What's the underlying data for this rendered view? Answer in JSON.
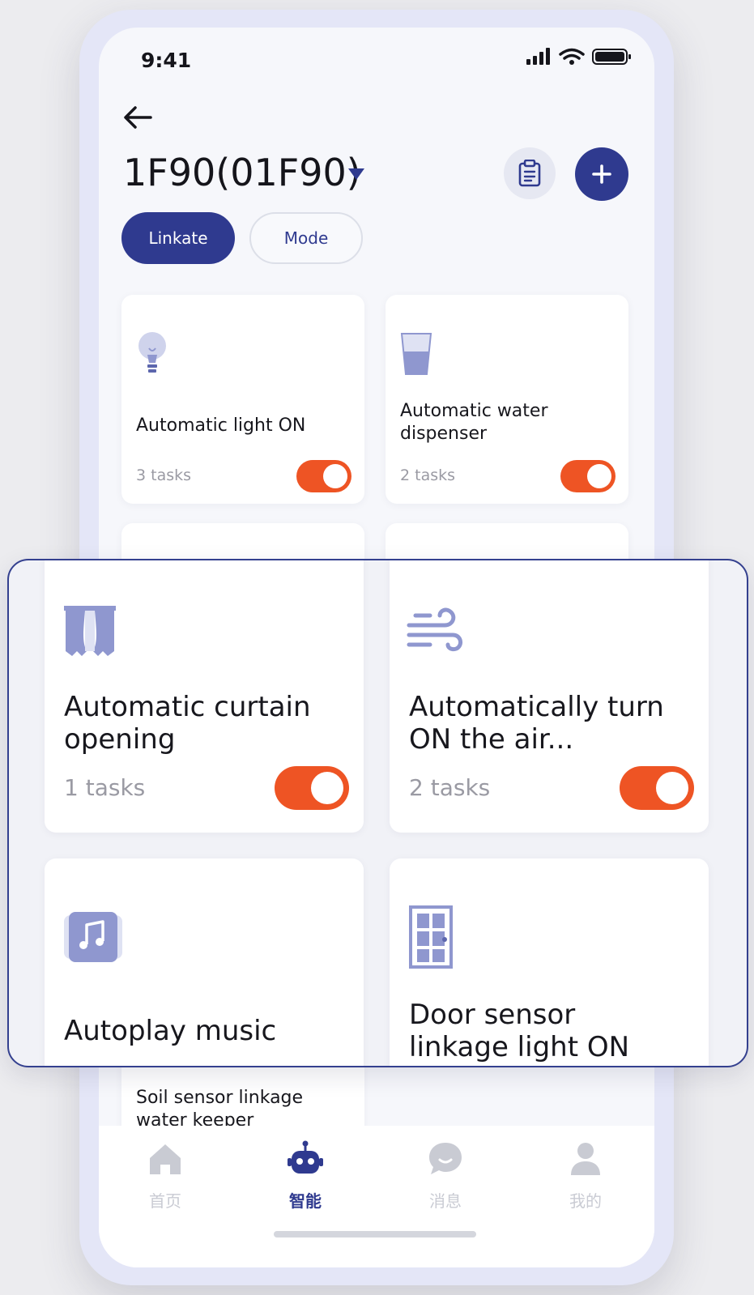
{
  "status_bar": {
    "time": "9:41"
  },
  "header": {
    "title": "1F90(01F90)"
  },
  "tabs": [
    {
      "label": "Linkate",
      "active": true
    },
    {
      "label": "Mode",
      "active": false
    }
  ],
  "scenes": [
    {
      "name": "Automatic light ON",
      "tasks": "3 tasks",
      "icon": "lightbulb-icon",
      "enabled": true
    },
    {
      "name": "Automatic water dispenser",
      "tasks": "2 tasks",
      "icon": "water-glass-icon",
      "enabled": true
    },
    {
      "name": "Soil sensor linkage water keeper",
      "icon": "soil-sensor-icon"
    }
  ],
  "zoomed_scenes": [
    {
      "name_line1": "Automatic curtain",
      "name_line2": "opening",
      "tasks": "1 tasks",
      "icon": "curtain-icon",
      "enabled": true
    },
    {
      "name_line1": "Automatically turn",
      "name_line2": "ON the air...",
      "tasks": "2 tasks",
      "icon": "wind-icon",
      "enabled": true
    },
    {
      "name_line1": "Autoplay music",
      "icon": "music-icon"
    },
    {
      "name_line1": "Door sensor",
      "name_line2": "linkage light ON",
      "icon": "door-icon"
    }
  ],
  "bottom_nav": [
    {
      "label": "首页",
      "icon": "home-icon",
      "active": false
    },
    {
      "label": "智能",
      "icon": "robot-icon",
      "active": true
    },
    {
      "label": "消息",
      "icon": "message-icon",
      "active": false
    },
    {
      "label": "我的",
      "icon": "profile-icon",
      "active": false
    }
  ],
  "colors": {
    "primary": "#2f3a8f",
    "toggle_on": "#ee5424",
    "icon_tint": "#8f97cf"
  }
}
